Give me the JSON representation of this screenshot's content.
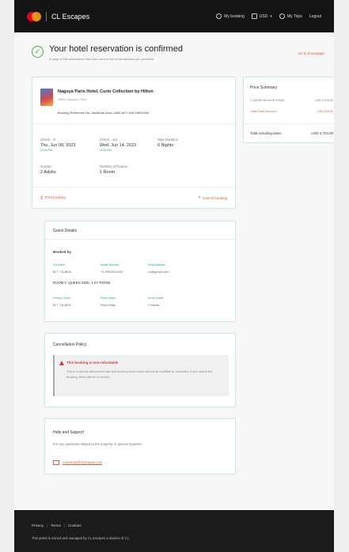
{
  "header": {
    "brand_name": "CL Escapes",
    "nav": {
      "my_booking": "My booking",
      "currency": "USD",
      "trips": "My Trips",
      "logout": "Logout"
    }
  },
  "confirmation": {
    "title": "Your hotel reservation is confirmed",
    "subtitle": "A copy of this reservation has been sent to the email address you provided.",
    "home_link": "Go to homepage"
  },
  "hotel": {
    "name": "Nagoya Paris Hotel, Curio Collection by Hilton",
    "address": "Hilton Nagoya, Paris",
    "booking_reference": "Booking Reference No: 5ac6f0ae-4bd1-4d09-af77-b3b749f320cb",
    "check_in_label": "Check - in",
    "check_in_value": "Thu, Jun 08, 2023",
    "check_in_time": "12:00 PM",
    "check_out_label": "Check - out",
    "check_out_value": "Wed, Jun 14, 2023",
    "check_out_time": "11:00 AM",
    "duration_label": "Stay Duration",
    "duration_value": "6 Nights",
    "guests_label": "Guests",
    "guests_value": "2 Adults",
    "rooms_label": "Number of Rooms",
    "rooms_value": "1 Room",
    "print_action": "Print booking",
    "cancel_action": "Cancel booking"
  },
  "price_summary": {
    "title": "Price Summary",
    "rows": [
      {
        "label": "1 QUEEN DELUXE ROOM",
        "value": "USD 2,919.00"
      },
      {
        "label": "Trade Rate Discount",
        "value": "- USD 215.00"
      }
    ],
    "total_label": "Total including taxes",
    "total_value": "USD 2,704.00"
  },
  "guest_details": {
    "title": "Guest Details",
    "booked_by": "Booked by",
    "fullname_label": "Full name",
    "fullname_value": "M.T. TA-BEA",
    "mobile_label": "Mobile Number",
    "mobile_value": "+1 9932514345",
    "email_label": "Email Address",
    "email_value": "xx@gmail.com",
    "room_label": "ROOM 1: QUEEN SIDE, 1 KY ROOM",
    "primary_guest_label": "Primary Guest",
    "primary_guest_value": "M.T. TA-BEA",
    "room_type_label": "Room status",
    "room_type_value": "Room stay",
    "adults_label": "No of Guests",
    "adults_value": "2 Adults"
  },
  "cancellation": {
    "title": "Cancellation Policy",
    "warn_title": "This booking is non-refundable",
    "warn_body": "This is a special discounted rate and booking once made cannot be modified or cancelled. If you cancel the booking, there will be no refund."
  },
  "help": {
    "title": "Help and Support",
    "text": "For any questions related to the property or special requests.",
    "email": "concierge@clescapes.com"
  },
  "footer": {
    "privacy": "Privacy",
    "terms": "Terms",
    "cookies": "Cookies",
    "sep": "|",
    "note": "This portal is owned and managed by CL Escapes a division of CL."
  },
  "colors": {
    "accent": "#e25b3a",
    "success": "#4caf50",
    "teal": "#27a387",
    "topbar": "#141414"
  }
}
